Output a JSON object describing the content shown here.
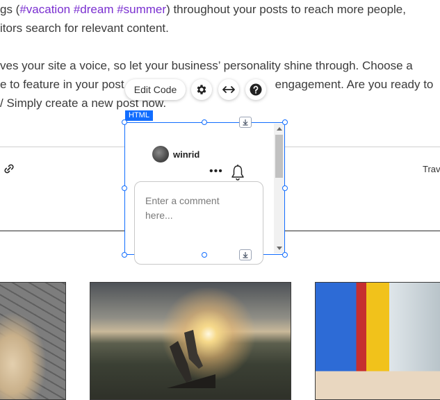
{
  "article": {
    "line1_a": "gs (",
    "line1_tags": "#vacation #dream #summer",
    "line1_b": ") throughout your posts to reach more people,",
    "line2": "itors search for relevant content.",
    "line3": "ves your site a voice, so let your business’ personality shine through. Choose a",
    "line4_a": "e to feature in your post",
    "line4_b": "engagement. Are you ready to",
    "line5": "Simply create a new post now."
  },
  "toolbar": {
    "edit_code_label": "Edit Code",
    "gear_icon": "gear-icon",
    "stretch_icon": "stretch-icon",
    "help_icon": "help-icon"
  },
  "element_badge": "HTML",
  "widget": {
    "username": "winrid",
    "more_icon": "•••",
    "comment_placeholder": "Enter a comment here..."
  },
  "post_meta": {
    "category_partial": "Trav"
  },
  "colors": {
    "selection": "#116dff",
    "hashtag": "#7a2fd0"
  }
}
